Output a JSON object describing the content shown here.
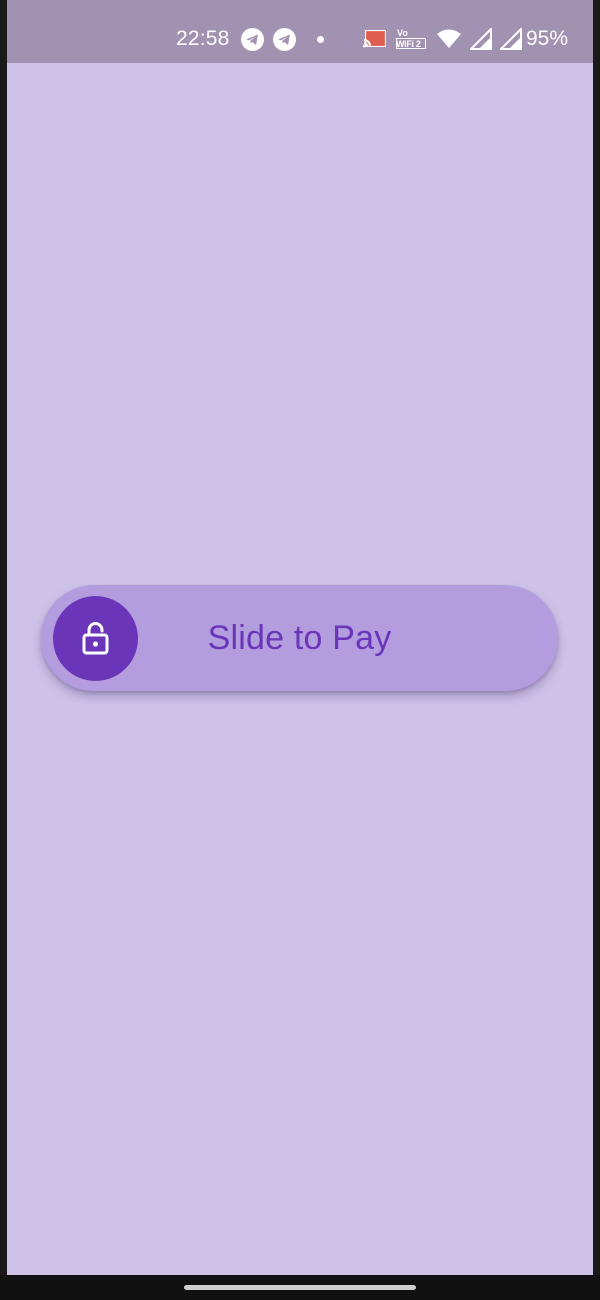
{
  "status_bar": {
    "time": "22:58",
    "battery_percent": "95%",
    "vowifi_top": "Vo",
    "vowifi_bottom": "WiFi 2",
    "icons": [
      "telegram-icon",
      "telegram-icon",
      "dot-icon",
      "cast-icon",
      "vowifi-icon",
      "wifi-icon",
      "signal-icon",
      "signal-icon"
    ],
    "background_color": "#a092b0"
  },
  "main": {
    "background_color": "#cec2e8",
    "slider": {
      "label": "Slide to Pay",
      "thumb_icon": "unlock-icon",
      "track_color": "#b39ddf",
      "thumb_color": "#6a35b8",
      "label_color": "#6a35b8",
      "progress": 0
    }
  }
}
